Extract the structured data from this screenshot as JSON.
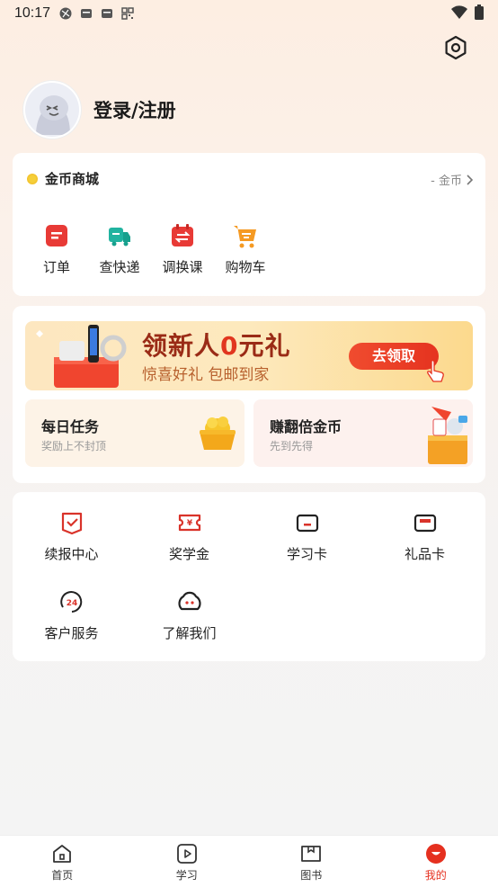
{
  "status_bar": {
    "time": "10:17"
  },
  "profile": {
    "login_label": "登录/注册"
  },
  "coin_mall": {
    "title": "金币商城",
    "balance": "- 金币",
    "items": [
      {
        "label": "订单",
        "icon": "order-icon"
      },
      {
        "label": "查快递",
        "icon": "truck-icon"
      },
      {
        "label": "调换课",
        "icon": "calendar-swap-icon"
      },
      {
        "label": "购物车",
        "icon": "cart-icon"
      }
    ]
  },
  "banner": {
    "headline_pre": "领新人",
    "headline_zero": "0",
    "headline_post": "元礼",
    "subtitle": "惊喜好礼 包邮到家",
    "button": "去领取"
  },
  "tasks": [
    {
      "title": "每日任务",
      "subtitle": "奖励上不封顶"
    },
    {
      "title": "赚翻倍金币",
      "subtitle": "先到先得"
    }
  ],
  "services": [
    {
      "label": "续报中心",
      "icon": "renew-icon"
    },
    {
      "label": "奖学金",
      "icon": "scholarship-ticket-icon"
    },
    {
      "label": "学习卡",
      "icon": "study-card-icon"
    },
    {
      "label": "礼品卡",
      "icon": "gift-card-icon"
    },
    {
      "label": "客户服务",
      "icon": "customer-service-24-icon"
    },
    {
      "label": "了解我们",
      "icon": "about-us-icon"
    }
  ],
  "tabbar": [
    {
      "label": "首页",
      "icon": "home-icon"
    },
    {
      "label": "学习",
      "icon": "study-play-icon"
    },
    {
      "label": "图书",
      "icon": "book-icon"
    },
    {
      "label": "我的",
      "icon": "me-icon"
    }
  ],
  "colors": {
    "accent": "#e5301f",
    "coin": "#f5c431",
    "banner_text": "#9a2b16"
  }
}
